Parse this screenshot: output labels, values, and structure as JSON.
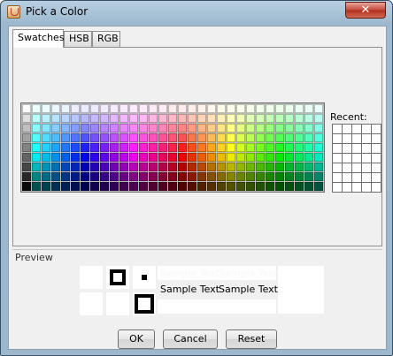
{
  "window": {
    "title": "Pick a Color",
    "close_symbol": "✕"
  },
  "tabs": [
    {
      "label": "Swatches",
      "active": true
    },
    {
      "label": "HSB",
      "active": false
    },
    {
      "label": "RGB",
      "active": false
    }
  ],
  "swatches": {
    "columns": 31,
    "rows": 9
  },
  "recent": {
    "label": "Recent:",
    "columns": 5,
    "rows": 7
  },
  "preview": {
    "label": "Preview",
    "sample_text": "Sample Text"
  },
  "buttons": {
    "ok": "OK",
    "cancel": "Cancel",
    "reset": "Reset"
  },
  "colors": {
    "title_bar": "#b8cfe0",
    "close_button": "#c6473a",
    "panel_bg": "#f0f0f0"
  }
}
